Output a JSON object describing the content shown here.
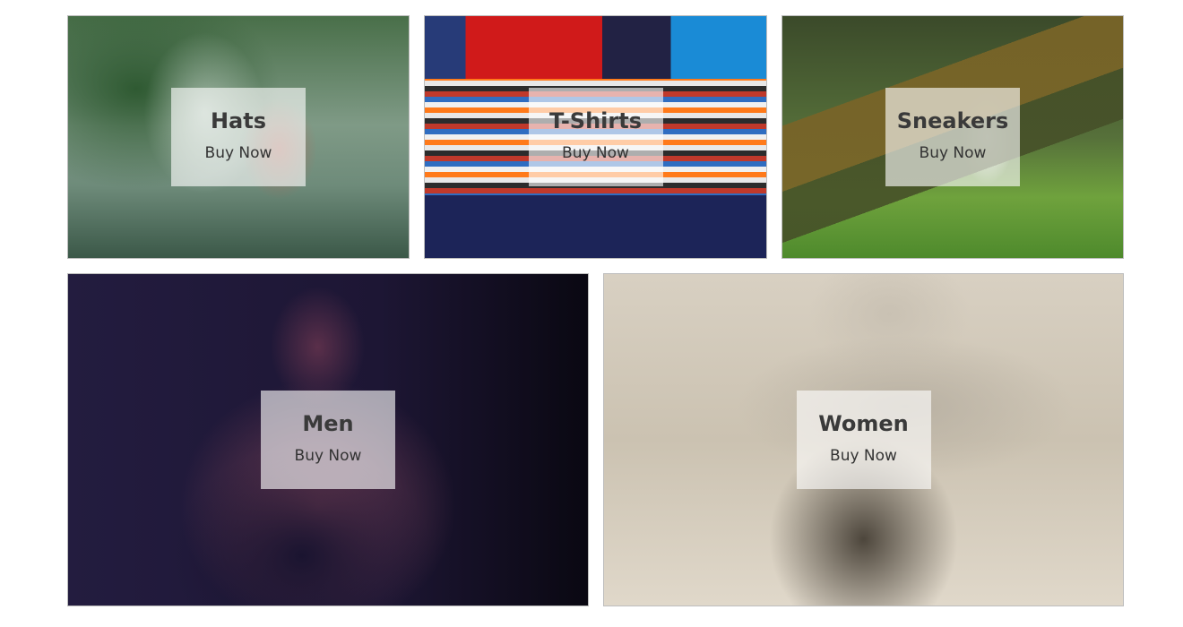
{
  "categories": [
    {
      "title": "Hats",
      "action": "Buy Now"
    },
    {
      "title": "T-Shirts",
      "action": "Buy Now"
    },
    {
      "title": "Sneakers",
      "action": "Buy Now"
    },
    {
      "title": "Men",
      "action": "Buy Now"
    },
    {
      "title": "Women",
      "action": "Buy Now"
    }
  ]
}
